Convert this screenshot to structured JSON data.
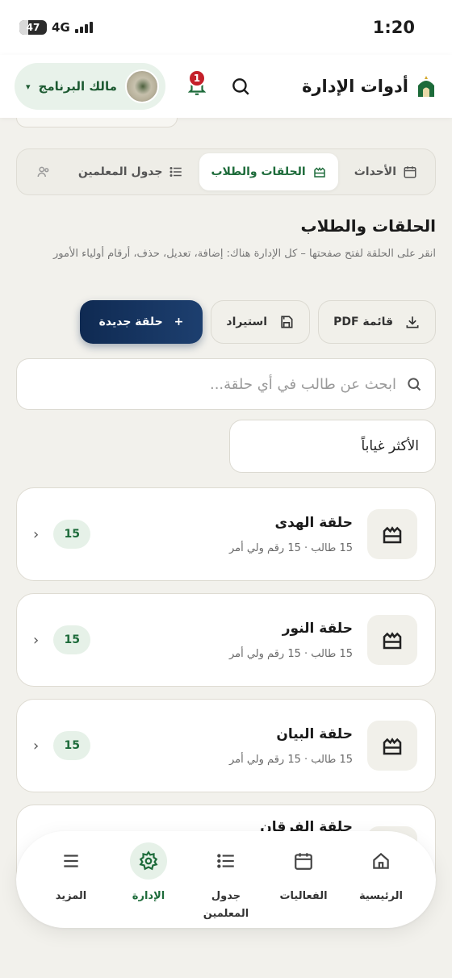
{
  "status_bar": {
    "battery": "47",
    "network": "4G",
    "time": "1:20"
  },
  "header": {
    "title": "أدوات الإدارة",
    "notification_count": "1",
    "owner_label": "مالك البرنامج",
    "owner_caret": "▾"
  },
  "tabs": [
    {
      "label": "الأحداث",
      "icon": "calendar-icon",
      "active": false
    },
    {
      "label": "الحلقات والطلاب",
      "icon": "castle-icon",
      "active": true
    },
    {
      "label": "جدول المعلمين",
      "icon": "list-icon",
      "active": false
    }
  ],
  "section": {
    "title": "الحلقات والطلاب",
    "description": "انقر على الحلقة لفتح صفحتها – كل الإدارة هناك: إضافة، تعديل، حذف، أرقام أولياء الأمور"
  },
  "actions": {
    "pdf_label": "قائمة PDF",
    "import_label": "استيراد",
    "new_label": "حلقة جديدة",
    "new_prefix": "+"
  },
  "search": {
    "placeholder": "ابحث عن طالب في أي حلقة..."
  },
  "sort": {
    "label": "الأكثر غياباً"
  },
  "circles": [
    {
      "name": "حلقة الهدى",
      "meta": "15 طالب · 15 رقم ولي أمر",
      "count": "15"
    },
    {
      "name": "حلقة النور",
      "meta": "15 طالب · 15 رقم ولي أمر",
      "count": "15"
    },
    {
      "name": "حلقة البيان",
      "meta": "15 طالب · 15 رقم ولي أمر",
      "count": "15"
    },
    {
      "name": "حلقة الفرقان",
      "meta": "",
      "count": ""
    }
  ],
  "bottom_nav": [
    {
      "label": "الرئيسية",
      "icon": "home-icon",
      "active": false
    },
    {
      "label": "الفعاليات",
      "icon": "calendar-icon",
      "active": false
    },
    {
      "label": "جدول المعلمين",
      "icon": "list-icon",
      "active": false
    },
    {
      "label": "الإدارة",
      "icon": "gear-icon",
      "active": true
    },
    {
      "label": "المزيد",
      "icon": "menu-icon",
      "active": false
    }
  ],
  "colors": {
    "accent_green": "#1d6b3a",
    "primary_navy": "#0f2a52",
    "badge_red": "#c4202a",
    "background": "#f2f1ec"
  }
}
